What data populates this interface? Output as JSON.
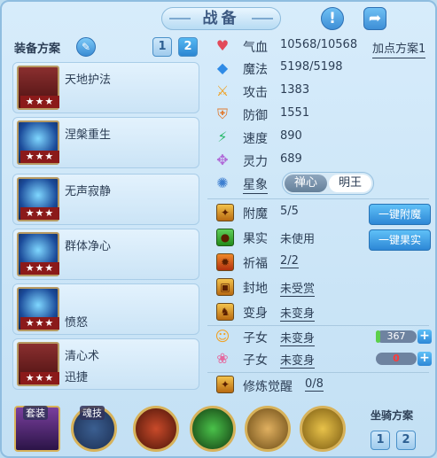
{
  "header": {
    "title": "战备",
    "info_icon": "exclamation-icon",
    "share_icon": "share-icon"
  },
  "equipment_plan": {
    "label": "装备方案",
    "buttons": [
      "1",
      "2"
    ],
    "selected": "2"
  },
  "skills": [
    {
      "name": "天地护法",
      "stars": "★★★"
    },
    {
      "name": "涅槃重生",
      "stars": "★★★"
    },
    {
      "name": "无声寂静",
      "stars": "★★★"
    },
    {
      "name": "群体净心",
      "stars": "★★★"
    },
    {
      "name": "",
      "sub": "愤怒",
      "stars": "★★★"
    },
    {
      "name": "清心术",
      "sub": "迅捷",
      "stars": "★★★"
    }
  ],
  "stats": [
    {
      "label": "气血",
      "value": "10568/10568",
      "color": "#e24a5a"
    },
    {
      "label": "魔法",
      "value": "5198/5198",
      "color": "#2f8be6"
    },
    {
      "label": "攻击",
      "value": "1383",
      "color": "#f0a020"
    },
    {
      "label": "防御",
      "value": "1551",
      "color": "#e07a30"
    },
    {
      "label": "速度",
      "value": "890",
      "color": "#27b86a"
    },
    {
      "label": "灵力",
      "value": "689",
      "color": "#b06ad8"
    }
  ],
  "add_point_plan": "加点方案1",
  "xingxiang": {
    "label": "星象",
    "options": [
      "禅心",
      "明王"
    ],
    "selected": "明王"
  },
  "extras": [
    {
      "label": "附魔",
      "value": "5/5",
      "green": true
    },
    {
      "label": "果实",
      "value": "未使用"
    },
    {
      "label": "祈福",
      "value": "2/2",
      "green": true
    },
    {
      "label": "封地",
      "value": "未受赏"
    },
    {
      "label": "变身",
      "value": "未变身"
    }
  ],
  "actions": {
    "enchant": "一键附魔",
    "fruit": "一键果实"
  },
  "children": [
    {
      "label": "子女",
      "value": "未变身",
      "count": "367",
      "fill": 0.1
    },
    {
      "label": "子女",
      "value": "未变身",
      "count": "0",
      "fill": 0
    }
  ],
  "awaken": {
    "label": "修炼觉醒",
    "value": "0/8"
  },
  "bottom": {
    "suit_tag": "套装",
    "soul_tag": "魂技",
    "mount_label": "坐骑方案",
    "mount_buttons": [
      "1",
      "2"
    ]
  }
}
